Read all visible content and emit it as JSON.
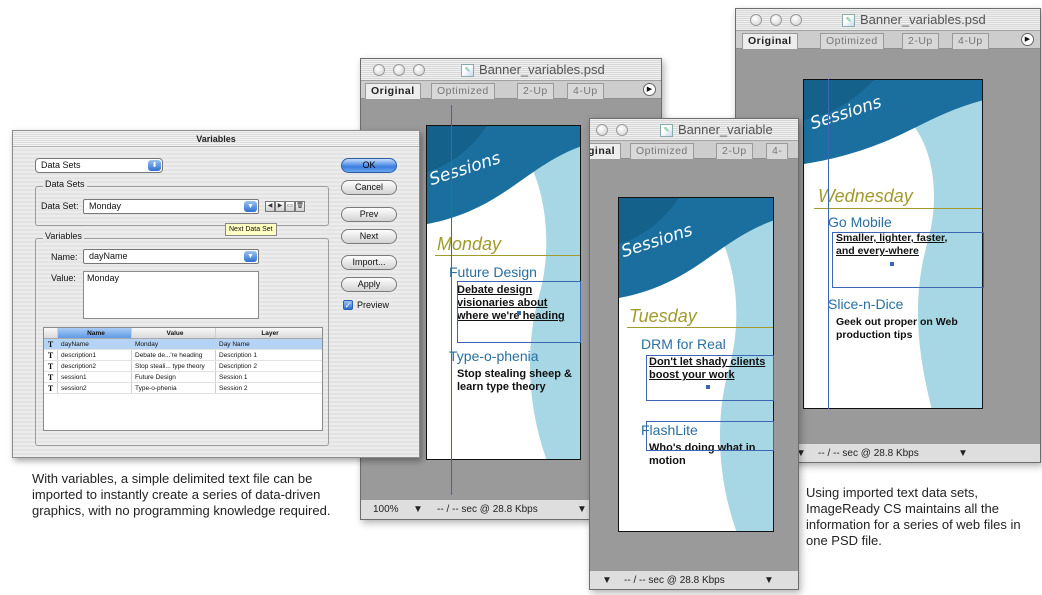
{
  "dialog": {
    "title": "Variables",
    "mode_popup": "Data Sets",
    "datasets_group": "Data Sets",
    "dataset_label": "Data Set:",
    "dataset_value": "Monday",
    "tooltip": "Next Data Set",
    "variables_group": "Variables",
    "name_label": "Name:",
    "name_value": "dayName",
    "value_label": "Value:",
    "value_value": "Monday",
    "buttons": {
      "ok": "OK",
      "cancel": "Cancel",
      "prev": "Prev",
      "next": "Next",
      "import": "Import...",
      "apply": "Apply"
    },
    "preview_label": "Preview",
    "preview_checked": true,
    "table": {
      "headers": [
        "Name",
        "Value",
        "Layer"
      ],
      "rows": [
        {
          "name": "dayName",
          "value": "Monday",
          "layer": "Day Name"
        },
        {
          "name": "description1",
          "value": "Debate de...'re heading",
          "layer": "Description 1"
        },
        {
          "name": "description2",
          "value": "Stop steali... type theory",
          "layer": "Description 2"
        },
        {
          "name": "session1",
          "value": "Future Design",
          "layer": "Session 1"
        },
        {
          "name": "session2",
          "value": "Type-o-phenia",
          "layer": "Session 2"
        }
      ]
    }
  },
  "windows": {
    "w1": {
      "title": "Banner_variables.psd",
      "tabs": [
        "Original",
        "Optimized",
        "2-Up",
        "4-Up"
      ],
      "status_zoom": "100%",
      "status_text": "-- / -- sec @ 28.8 Kbps",
      "banner": {
        "word": "Sessions",
        "day": "Monday",
        "title1": "Future Design",
        "desc1": "Debate design visionaries about where we're heading",
        "title2": "Type-o-phenia",
        "desc2": "Stop stealing sheep & learn type theory"
      }
    },
    "w2": {
      "title": "Banner_variable",
      "tabs": [
        "ginal",
        "Optimized",
        "2-Up",
        "4-"
      ],
      "status_text": "-- / -- sec @ 28.8 Kbps",
      "banner": {
        "word": "Sessions",
        "day": "Tuesday",
        "title1": "DRM for Real",
        "desc1": "Don't let shady clients boost your work",
        "title2": "FlashLite",
        "desc2": "Who's doing what in motion"
      }
    },
    "w3": {
      "title": "Banner_variables.psd",
      "tabs": [
        "Original",
        "Optimized",
        "2-Up",
        "4-Up"
      ],
      "status_text": "-- / -- sec @ 28.8 Kbps",
      "banner": {
        "word": "Sessions",
        "day": "Wednesday",
        "title1": "Go Mobile",
        "desc1": "Smaller, lighter, faster, and every-where",
        "title2": "Slice-n-Dice",
        "desc2": "Geek out proper on Web production tips"
      }
    }
  },
  "captions": {
    "left": "With variables, a simple delimited text file can be imported to instantly create a series of data-driven graphics, with no programming knowledge required.",
    "right": "Using imported text data sets, ImageReady CS maintains all the information for a series of web files in one PSD file."
  },
  "colors": {
    "banner_blue": "#1a6f9e",
    "banner_light": "#a7d7e4",
    "day_gold": "#a39a2c",
    "title_blue": "#2a6fa0"
  }
}
